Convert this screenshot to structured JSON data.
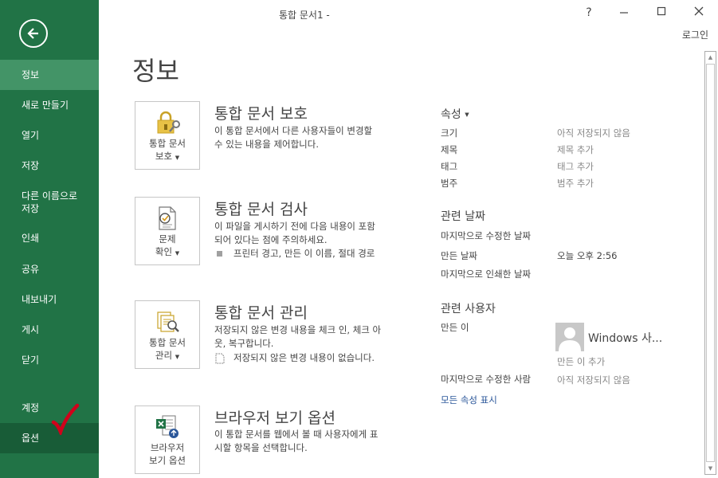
{
  "window": {
    "title": "통합 문서1 -",
    "help_label": "?",
    "login_label": "로그인"
  },
  "sidebar": {
    "items": [
      {
        "label": "정보"
      },
      {
        "label": "새로 만들기"
      },
      {
        "label": "열기"
      },
      {
        "label": "저장"
      },
      {
        "label": "다른 이름으로\n저장"
      },
      {
        "label": "인쇄"
      },
      {
        "label": "공유"
      },
      {
        "label": "내보내기"
      },
      {
        "label": "게시"
      },
      {
        "label": "닫기"
      },
      {
        "label": "계정"
      },
      {
        "label": "옵션"
      }
    ],
    "bg_color": "#217346",
    "selected_color": "#439467"
  },
  "main": {
    "page_title": "정보",
    "sections": [
      {
        "tile_label_1": "통합 문서",
        "tile_label_2": "보호",
        "title": "통합 문서 보호",
        "desc": "이 통합 문서에서 다른 사용자들이 변경할 수 있는 내용을 제어합니다.",
        "icon": "lock-icon"
      },
      {
        "tile_label_1": "문제",
        "tile_label_2": "확인",
        "title": "통합 문서 검사",
        "desc": "이 파일을 게시하기 전에 다음 내용이 포함되어 있다는 점에 주의하세요.",
        "bullet": "프린터 경고, 만든 이 이름, 절대 경로",
        "icon": "inspect-document-icon"
      },
      {
        "tile_label_1": "통합 문서",
        "tile_label_2": "관리",
        "title": "통합 문서 관리",
        "desc": "저장되지 않은 변경 내용을 체크 인, 체크 아웃, 복구합니다.",
        "bullet": "저장되지 않은 변경 내용이 없습니다.",
        "icon": "manage-workbook-icon"
      },
      {
        "tile_label_1": "브라우저",
        "tile_label_2": "보기 옵션",
        "title": "브라우저 보기 옵션",
        "desc": "이 통합 문서를 웹에서 볼 때 사용자에게 표시할 항목을 선택합니다.",
        "icon": "excel-browser-icon"
      }
    ]
  },
  "properties": {
    "header": "속성",
    "rows": [
      {
        "label": "크기",
        "value": "아직 저장되지 않음"
      },
      {
        "label": "제목",
        "value": "제목 추가"
      },
      {
        "label": "태그",
        "value": "태그 추가"
      },
      {
        "label": "범주",
        "value": "범주 추가"
      }
    ],
    "dates_header": "관련 날짜",
    "dates": [
      {
        "label": "마지막으로 수정한 날짜",
        "value": ""
      },
      {
        "label": "만든 날짜",
        "value": "오늘 오후 2:56"
      },
      {
        "label": "마지막으로 인쇄한 날짜",
        "value": ""
      }
    ],
    "people_header": "관련 사용자",
    "author_label": "만든 이",
    "author_name": "Windows 사...",
    "add_author": "만든 이 추가",
    "last_modified_by_label": "마지막으로 수정한 사람",
    "last_modified_by_value": "아직 저장되지 않음",
    "show_all": "모든 속성 표시"
  }
}
